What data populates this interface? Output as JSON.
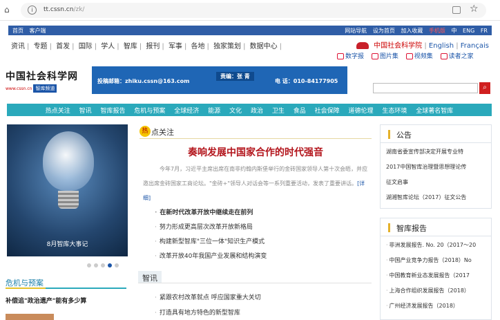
{
  "browser": {
    "url_host": "tt.cssn.cn",
    "url_path": "/zk/"
  },
  "topbar": {
    "left": [
      "首页",
      "客户端"
    ],
    "right": [
      "网站导航",
      "设为首页",
      "加入收藏",
      "手机版",
      "中",
      "ENG",
      "FR"
    ]
  },
  "nav": {
    "items": [
      "资讯",
      "专题",
      "首发",
      "国际",
      "学人",
      "智库",
      "报刊",
      "军事",
      "各地",
      "独家策划",
      "数据中心"
    ],
    "cass": "中国社会科学院",
    "english": "English",
    "francais": "Français"
  },
  "subnav": [
    "数字报",
    "图片集",
    "视频集",
    "读者之家"
  ],
  "logo": {
    "title": "中国社会科学网",
    "subtitle": "www.cssn.cn",
    "badge": "智库频道"
  },
  "banner": {
    "email": "投稿邮箱：zhiku.cssn@163.com",
    "editor": "责编：张 青",
    "phone": "电 话：010-84177905"
  },
  "channels": [
    "热点关注",
    "智讯",
    "智库报告",
    "危机与预案",
    "全球经济",
    "能源",
    "文化",
    "政治",
    "卫生",
    "食品",
    "社会保障",
    "道德伦理",
    "生态环境",
    "全球著名智库"
  ],
  "hero": {
    "caption": "8月智库大事记",
    "slides": 5,
    "active": 3
  },
  "crisis": {
    "title": "危机与预案",
    "item": "补偿追\"政治遗产\"能有多少算"
  },
  "hot": {
    "icon": "热",
    "label": "点关注",
    "headline": "奏响发展中国家合作的时代强音",
    "summary": "今年7月，习近平主席出席在南非约翰内斯堡举行的金砖国家领导人第十次会晤，并应邀出席金砖国家工商论坛。\"金砖+\"领导人对话会等一系列重要活动，发表了重要讲话。",
    "detail": "[详细]",
    "news": [
      "在新时代改革开放中继续走在前列",
      "努力形成更高层次改革开放新格局",
      "构建新型智库\"三位一体\"知识生产模式",
      "改革开放40年我国产业发展和结构演变"
    ]
  },
  "zixun": {
    "tab": "智讯",
    "news": [
      "紧跟农村改革就点 呼应国家重大关切",
      "打造具有地方特色的新型智库"
    ]
  },
  "notice": {
    "title": "公告",
    "items": [
      "湖南省委宣传部决定开展专业特",
      "2017中国智库治理暨思想理论传",
      "征文启事",
      "湖湘智库论坛（2017）征文公告"
    ]
  },
  "reports": {
    "title": "智库报告",
    "items": [
      "非洲发展报告. No. 20（2017～20",
      "中国产业竞争力报告（2018）No",
      "中国教育新业态发展报告（2017",
      "上海合作组织发展报告（2018）",
      "广州经济发展报告（2018）"
    ]
  }
}
